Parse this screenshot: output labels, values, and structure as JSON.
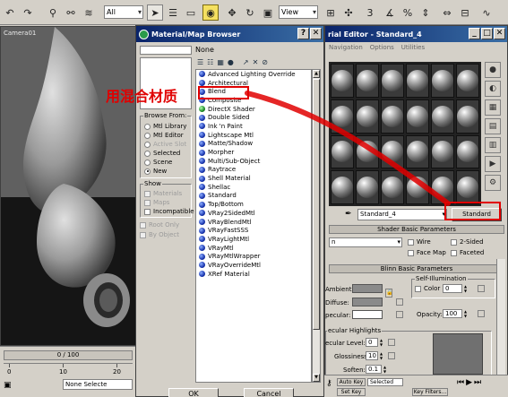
{
  "toolbar": {
    "selection_filter": "All",
    "view_mode": "View"
  },
  "viewport": {
    "label": "Camera01"
  },
  "timeline": {
    "frame_counter": "0 / 100",
    "ruler_ticks": [
      "0",
      "10",
      "20"
    ],
    "status_text": "None Selecte"
  },
  "browser": {
    "title": "Material/Map Browser",
    "name_value": "None",
    "browse_from": {
      "title": "Browse From:",
      "options": [
        "Mtl Library",
        "Mtl Editor",
        "Active Slot",
        "Selected",
        "Scene",
        "New"
      ],
      "selected": "New"
    },
    "show": {
      "title": "Show",
      "options": [
        "Materials",
        "Maps",
        "Incompatible"
      ],
      "extra_options": [
        "Root Only",
        "By Object"
      ]
    },
    "materials": [
      "Advanced Lighting Override",
      "Architectural",
      "Blend",
      "Composite",
      "DirectX Shader",
      "Double Sided",
      "Ink 'n Paint",
      "Lightscape Mtl",
      "Matte/Shadow",
      "Morpher",
      "Multi/Sub-Object",
      "Raytrace",
      "Shell Material",
      "Shellac",
      "Standard",
      "Top/Bottom",
      "VRay2SidedMtl",
      "VRayBlendMtl",
      "VRayFastSSS",
      "VRayLightMtl",
      "VRayMtl",
      "VRayMtlWrapper",
      "VRayOverrideMtl",
      "XRef Material"
    ],
    "ok_label": "OK",
    "cancel_label": "Cancel"
  },
  "editor": {
    "title": "rial Editor - Standard_4",
    "menus": [
      "Navigation",
      "Options",
      "Utilities"
    ],
    "material_name": "Standard_4",
    "type_button": "Standard",
    "shader_rollout": "Shader Basic Parameters",
    "shader_value": "n",
    "shader_options": [
      "Wire",
      "2-Sided",
      "Face Map",
      "Faceted"
    ],
    "blinn_rollout": "Blinn Basic Parameters",
    "self_illum_title": "Self-Illumination",
    "color_label": "Color",
    "color_value": "0",
    "ambient_label": "Ambient:",
    "diffuse_label": "Diffuse:",
    "specular_label": "pecular:",
    "opacity_label": "Opacity:",
    "opacity_value": "100",
    "specular_title": "ecular Highlights",
    "spec_level_label": "ecular Level:",
    "spec_level_value": "0",
    "glossiness_label": "Glossiness:",
    "glossiness_value": "10",
    "soften_label": "Soften:",
    "soften_value": "0.1",
    "bottom_labels": [
      "Auto Key",
      "Selected",
      "Set Key",
      "Key Filters..."
    ]
  },
  "annotation": {
    "text": "用混合材质",
    "color": "#e00000"
  }
}
